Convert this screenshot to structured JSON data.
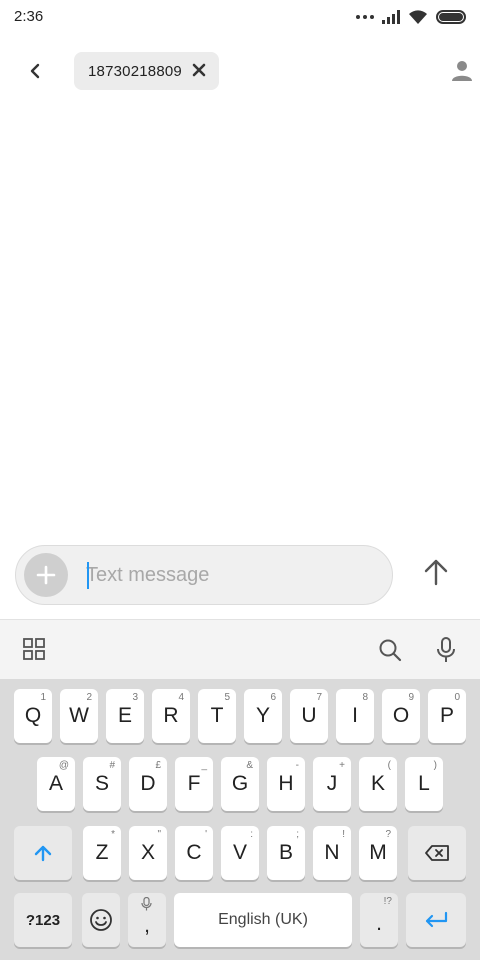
{
  "status_bar": {
    "time": "2:36"
  },
  "header": {
    "recipient": "18730218809"
  },
  "compose": {
    "placeholder": "Text message"
  },
  "keyboard": {
    "row1": [
      {
        "label": "Q",
        "hint": "1"
      },
      {
        "label": "W",
        "hint": "2"
      },
      {
        "label": "E",
        "hint": "3"
      },
      {
        "label": "R",
        "hint": "4"
      },
      {
        "label": "T",
        "hint": "5"
      },
      {
        "label": "Y",
        "hint": "6"
      },
      {
        "label": "U",
        "hint": "7"
      },
      {
        "label": "I",
        "hint": "8"
      },
      {
        "label": "O",
        "hint": "9"
      },
      {
        "label": "P",
        "hint": "0"
      }
    ],
    "row2": [
      {
        "label": "A",
        "hint": "@"
      },
      {
        "label": "S",
        "hint": "#"
      },
      {
        "label": "D",
        "hint": "£"
      },
      {
        "label": "F",
        "hint": "_"
      },
      {
        "label": "G",
        "hint": "&"
      },
      {
        "label": "H",
        "hint": "-"
      },
      {
        "label": "J",
        "hint": "+"
      },
      {
        "label": "K",
        "hint": "("
      },
      {
        "label": "L",
        "hint": ")"
      }
    ],
    "row3": [
      {
        "label": "Z",
        "hint": "*"
      },
      {
        "label": "X",
        "hint": "\""
      },
      {
        "label": "C",
        "hint": "'"
      },
      {
        "label": "V",
        "hint": ":"
      },
      {
        "label": "B",
        "hint": ";"
      },
      {
        "label": "N",
        "hint": "!"
      },
      {
        "label": "M",
        "hint": "?"
      }
    ],
    "symbols_label": "?123",
    "comma_label": ",",
    "space_label": "English (UK)",
    "period_label": ".",
    "period_hint": "!?"
  },
  "icons": {
    "back": "back-chevron-icon",
    "clear": "close-icon",
    "contact": "person-icon",
    "attach": "plus-icon",
    "send": "arrow-up-icon",
    "apps": "grid-icon",
    "search": "search-icon",
    "mic": "mic-icon",
    "shift": "shift-arrow-icon",
    "backspace": "backspace-icon",
    "emoji": "emoji-icon",
    "enter": "enter-icon"
  },
  "colors": {
    "accent": "#2196f3",
    "keyboard_bg": "#dadada",
    "chip_bg": "#ececec"
  }
}
